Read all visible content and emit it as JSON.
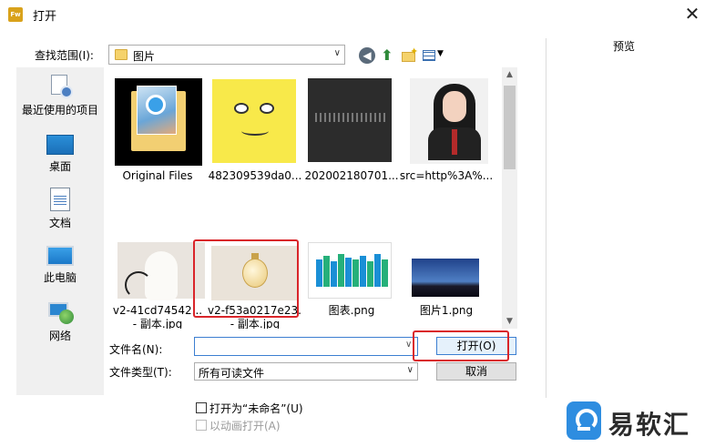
{
  "window": {
    "title": "打开",
    "app_icon_text": "Fw",
    "close_glyph": "✕"
  },
  "lookin": {
    "label": "查找范围(I):",
    "value": "图片"
  },
  "sidebar": {
    "items": [
      {
        "label": "最近使用的项目",
        "icon": "recent-items-icon"
      },
      {
        "label": "桌面",
        "icon": "desktop-icon"
      },
      {
        "label": "文档",
        "icon": "documents-icon"
      },
      {
        "label": "此电脑",
        "icon": "computer-icon"
      },
      {
        "label": "网络",
        "icon": "network-icon"
      }
    ]
  },
  "files": [
    {
      "name": "Original Files",
      "icon": "folder-icon"
    },
    {
      "name": "482309539da0...",
      "icon": "image-thumbnail"
    },
    {
      "name": "202002180701...",
      "icon": "image-thumbnail"
    },
    {
      "name": "src=http%3A%...",
      "icon": "image-thumbnail"
    },
    {
      "name": "v2-41cd74542...",
      "name2": "- 副本.jpg",
      "icon": "image-thumbnail"
    },
    {
      "name": "v2-f53a0217e23...",
      "name2": "- 副本.jpg",
      "icon": "image-thumbnail"
    },
    {
      "name": "图表.png",
      "icon": "image-thumbnail"
    },
    {
      "name": "图片1.png",
      "icon": "image-thumbnail"
    }
  ],
  "chart_thumb_colors": [
    "#1a8fd6",
    "#26b07a",
    "#1a8fd6",
    "#26b07a",
    "#1a8fd6",
    "#26b07a",
    "#1a8fd6",
    "#26b07a",
    "#1a8fd6",
    "#26b07a"
  ],
  "form": {
    "filename_label": "文件名(N):",
    "filename_value": "",
    "filetype_label": "文件类型(T):",
    "filetype_value": "所有可读文件",
    "open_button": "打开(O)",
    "cancel_button": "取消",
    "open_as_untitled": "打开为“未命名”(U)",
    "open_as_animation": "以动画打开(A)"
  },
  "preview": {
    "label": "预览"
  },
  "watermark": {
    "text": "易软汇"
  },
  "colors": {
    "highlight_red": "#d9252a",
    "accent_blue": "#3c7fd1"
  }
}
